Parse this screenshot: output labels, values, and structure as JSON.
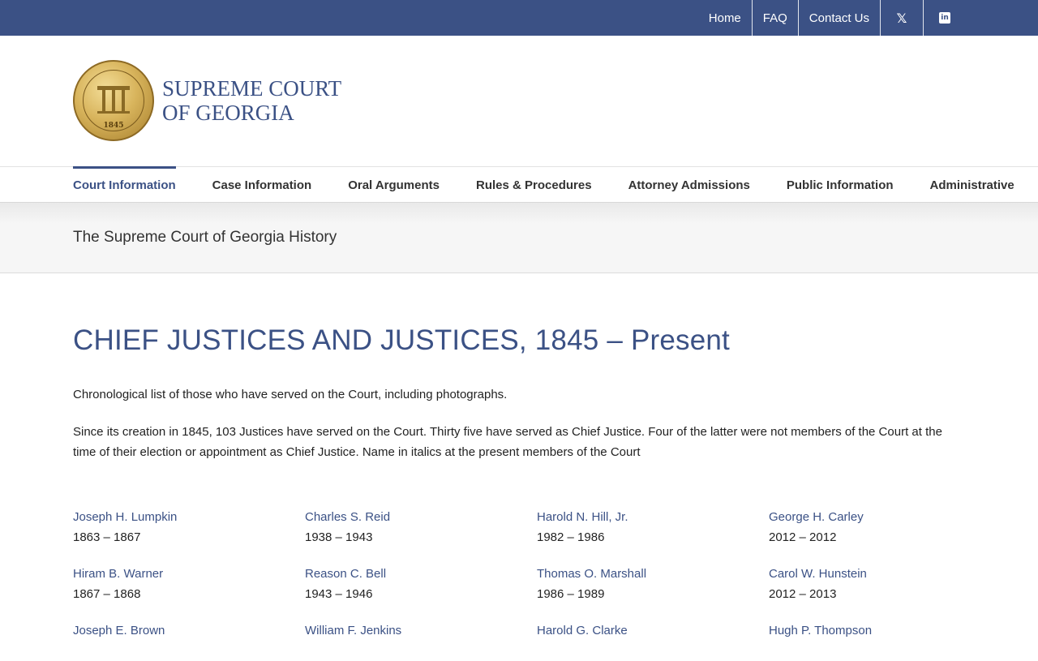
{
  "topbar": {
    "links": [
      "Home",
      "FAQ",
      "Contact Us"
    ],
    "social": [
      {
        "icon": "x-twitter-icon",
        "glyph": "𝕏"
      },
      {
        "icon": "linkedin-icon",
        "glyph": "in"
      }
    ]
  },
  "logo": {
    "line1": "SUPREME COURT",
    "line2": "OF GEORGIA",
    "seal_year": "1845"
  },
  "nav": [
    "Court Information",
    "Case Information",
    "Oral Arguments",
    "Rules & Procedures",
    "Attorney Admissions",
    "Public Information",
    "Administrative"
  ],
  "page_title": "The Supreme Court of Georgia History",
  "main": {
    "heading": "CHIEF JUSTICES AND JUSTICES, 1845 – Present",
    "intro": "Chronological list of those who have served on the Court, including photographs.",
    "description": "Since its creation in 1845, 103 Justices have served on the Court.  Thirty five have served as Chief Justice.  Four of the latter were not members of the Court at the time of their election or appointment as Chief Justice.  Name in italics at the present members of the Court"
  },
  "justices": [
    {
      "name": "Joseph H. Lumpkin",
      "years": "1863 – 1867"
    },
    {
      "name": "Charles S. Reid",
      "years": "1938 – 1943"
    },
    {
      "name": "Harold N. Hill, Jr.",
      "years": "1982 – 1986"
    },
    {
      "name": "George H. Carley",
      "years": "2012 – 2012"
    },
    {
      "name": "Hiram B. Warner",
      "years": "1867 – 1868"
    },
    {
      "name": "Reason C. Bell",
      "years": "1943 – 1946"
    },
    {
      "name": "Thomas O. Marshall",
      "years": "1986 – 1989"
    },
    {
      "name": "Carol W. Hunstein",
      "years": "2012 – 2013"
    },
    {
      "name": "Joseph E. Brown",
      "years": ""
    },
    {
      "name": "William F. Jenkins",
      "years": ""
    },
    {
      "name": "Harold G. Clarke",
      "years": ""
    },
    {
      "name": "Hugh P. Thompson",
      "years": ""
    }
  ],
  "colors": {
    "brand": "#3b5185",
    "topbar": "#3b5185"
  }
}
